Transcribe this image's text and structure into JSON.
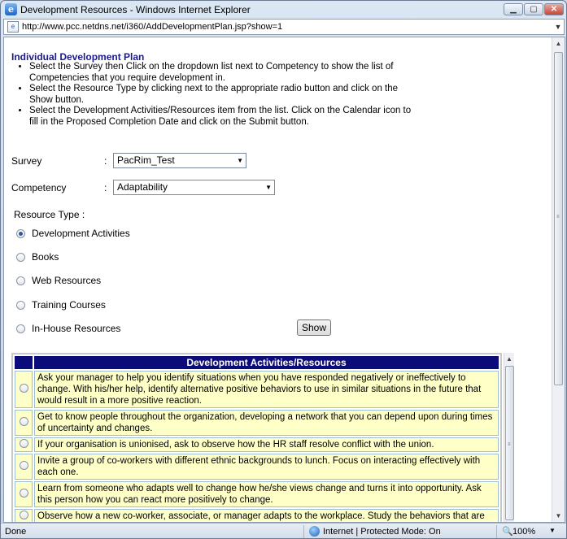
{
  "window": {
    "title": "Development Resources - Windows Internet Explorer",
    "url": "http://www.pcc.netdns.net/i360/AddDevelopmentPlan.jsp?show=1"
  },
  "page": {
    "heading": "Individual Development Plan",
    "instructions": [
      "Select the Survey then Click on the dropdown list next to Competency to show the list of Competencies that you require development in.",
      "Select the Resource Type by clicking next to the appropriate radio button and click on the Show button.",
      "Select the Development Activities/Resources item from the list. Click on the Calendar icon to fill in the Proposed Completion Date and click on the Submit button."
    ],
    "survey_label": "Survey",
    "survey_value": "PacRim_Test",
    "competency_label": "Competency",
    "competency_value": "Adaptability",
    "colon": ":",
    "resource_type_label": "Resource Type :",
    "resource_types": [
      {
        "label": "Development Activities",
        "selected": true
      },
      {
        "label": "Books",
        "selected": false
      },
      {
        "label": "Web Resources",
        "selected": false
      },
      {
        "label": "Training Courses",
        "selected": false
      },
      {
        "label": "In-House Resources",
        "selected": false
      }
    ],
    "show_button": "Show",
    "table_header": "Development Activities/Resources",
    "activities": [
      "Ask your manager to help you identify situations when you have responded negatively or ineffectively to change. With his/her help, identify alternative positive behaviors to use in similar situations in the future that would result in a more positive reaction.",
      "Get to know people throughout the organization, developing a network that you can depend upon during times of uncertainty and changes.",
      "If your organisation is unionised, ask to observe how the HR staff resolve conflict with the union.",
      "Invite a group of co-workers with different ethnic backgrounds to lunch. Focus on interacting effectively with each one.",
      "Learn from someone who adapts well to change how he/she views change and turns it into opportunity. Ask this person how you can react more positively to change.",
      "Observe how a new co-worker, associate, or manager adapts to the workplace. Study the behaviors that are"
    ]
  },
  "status": {
    "left": "Done",
    "zone": "Internet | Protected Mode: On",
    "zoom": "100%"
  },
  "icons": {
    "app": "ie-icon",
    "page": "page-icon",
    "globe": "globe-icon",
    "zoom": "zoom-icon"
  }
}
